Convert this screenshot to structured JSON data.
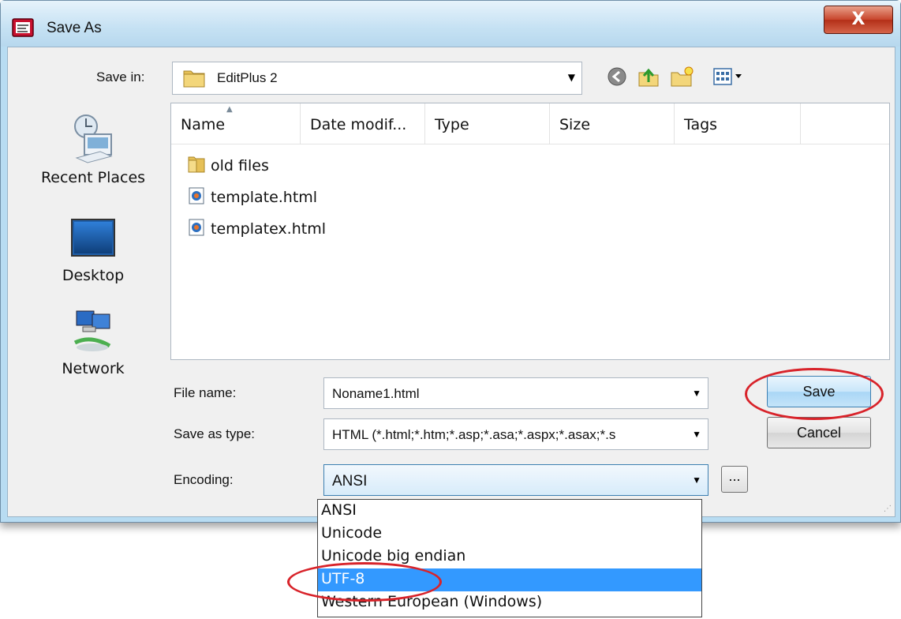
{
  "window": {
    "title": "Save As",
    "close_label": "X"
  },
  "toolbar": {
    "save_in_label": "Save in:",
    "save_in_value": "EditPlus 2"
  },
  "places": [
    {
      "label": "Recent Places"
    },
    {
      "label": "Desktop"
    },
    {
      "label": "Network"
    }
  ],
  "columns": [
    "Name",
    "Date modif...",
    "Type",
    "Size",
    "Tags"
  ],
  "files": [
    {
      "name": "old files",
      "icon": "folder-icon"
    },
    {
      "name": "template.html",
      "icon": "html-file-icon"
    },
    {
      "name": "templatex.html",
      "icon": "html-file-icon"
    }
  ],
  "form": {
    "filename_label": "File name:",
    "filename_value": "Noname1.html",
    "type_label": "Save as type:",
    "type_value": "HTML (*.html;*.htm;*.asp;*.asa;*.aspx;*.asax;*.s",
    "encoding_label": "Encoding:",
    "encoding_value": "ANSI",
    "save_label": "Save",
    "cancel_label": "Cancel",
    "browse_label": "..."
  },
  "encoding_options": [
    {
      "label": "ANSI",
      "selected": false
    },
    {
      "label": "Unicode",
      "selected": false
    },
    {
      "label": "Unicode big endian",
      "selected": false
    },
    {
      "label": "UTF-8",
      "selected": true
    },
    {
      "label": "Western European (Windows)",
      "selected": false
    }
  ],
  "colors": {
    "highlight": "#3399ff",
    "annotation": "#d8232a",
    "window_frame": "#b8dcf2"
  }
}
